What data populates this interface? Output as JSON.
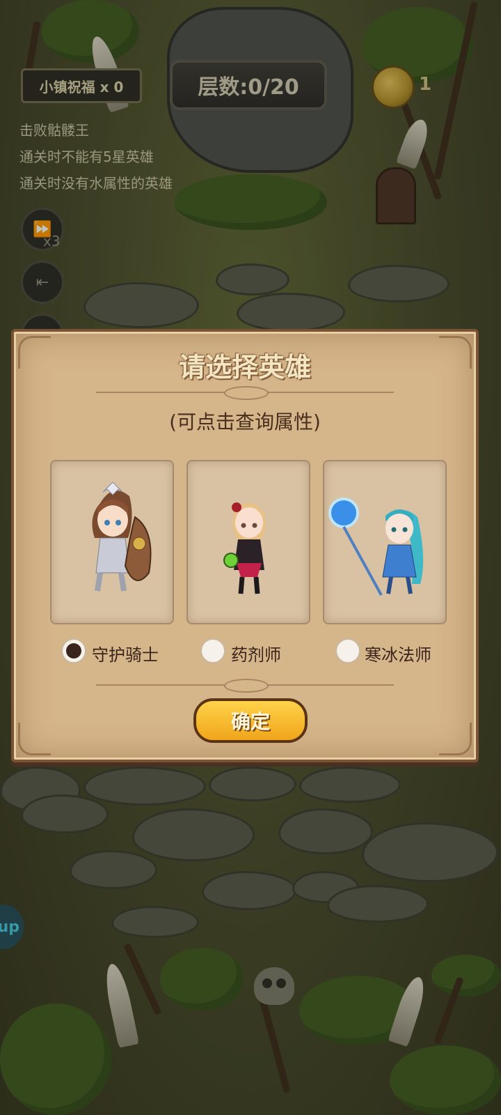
{
  "hud": {
    "blessing_label": "小镇祝福 x 0",
    "floor_label": "层数:0/20",
    "coin_count": "1",
    "objectives": [
      "击败骷髅王",
      "通关时不能有5星英雄",
      "通关时没有水属性的英雄"
    ],
    "speed_label": "x3",
    "side_badge": "up"
  },
  "dialog": {
    "title": "请选择英雄",
    "subtitle": "(可点击查询属性)",
    "heroes": [
      {
        "name": "守护骑士",
        "selected": true,
        "icon": "guardian-knight-portrait"
      },
      {
        "name": "药剂师",
        "selected": false,
        "icon": "alchemist-portrait"
      },
      {
        "name": "寒冰法师",
        "selected": false,
        "icon": "frost-mage-portrait"
      }
    ],
    "confirm_label": "确定"
  },
  "colors": {
    "dialog_bg": "#d5b58a",
    "confirm_button": "#f0a51b",
    "title_text": "#f4e6c2"
  }
}
